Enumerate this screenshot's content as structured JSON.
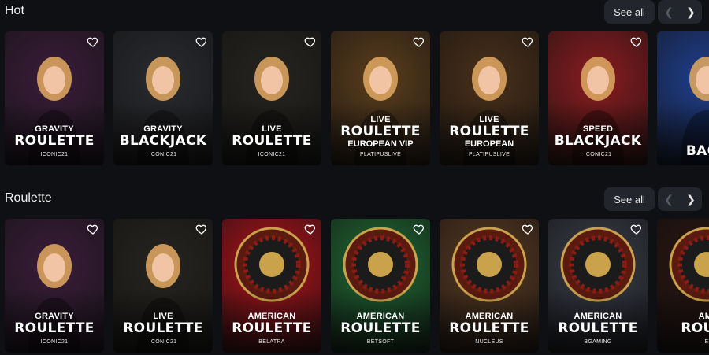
{
  "sections": {
    "hot": {
      "title": "Hot",
      "see_all": "See all",
      "cards": [
        {
          "line1": "GRAVITY",
          "line2": "ROULETTE",
          "line3": "",
          "provider": "ICONIC21",
          "color": "#3a1d3a"
        },
        {
          "line1": "GRAVITY",
          "line2": "BLACKJACK",
          "line3": "",
          "provider": "ICONIC21",
          "color": "#2a2b30"
        },
        {
          "line1": "LIVE",
          "line2": "ROULETTE",
          "line3": "",
          "provider": "ICONIC21",
          "color": "#26241f"
        },
        {
          "line1": "LIVE",
          "line2": "ROULETTE",
          "line3": "EUROPEAN VIP",
          "provider": "PLATIPUSLIVE",
          "color": "#5b3d1c"
        },
        {
          "line1": "LIVE",
          "line2": "ROULETTE",
          "line3": "EUROPEAN",
          "provider": "PLATIPUSLIVE",
          "color": "#4a3019"
        },
        {
          "line1": "SPEED",
          "line2": "BLACKJACK",
          "line3": "",
          "provider": "ICONIC21",
          "color": "#8b1c1f"
        },
        {
          "line1": "",
          "line2": "BACC",
          "line3": "",
          "provider": "",
          "color": "#1f3f8f"
        }
      ]
    },
    "roulette": {
      "title": "Roulette",
      "see_all": "See all",
      "cards": [
        {
          "line1": "GRAVITY",
          "line2": "ROULETTE",
          "line3": "",
          "provider": "ICONIC21",
          "color": "#3a1d3a"
        },
        {
          "line1": "LIVE",
          "line2": "ROULETTE",
          "line3": "",
          "provider": "ICONIC21",
          "color": "#26241f"
        },
        {
          "line1": "AMERICAN",
          "line2": "ROULETTE",
          "line3": "",
          "provider": "BELATRA",
          "color": "#b0121a"
        },
        {
          "line1": "AMERICAN",
          "line2": "ROULETTE",
          "line3": "",
          "provider": "BETSOFT",
          "color": "#1f6a34"
        },
        {
          "line1": "AMERICAN",
          "line2": "ROULETTE",
          "line3": "",
          "provider": "NUCLEUS",
          "color": "#5a3a22"
        },
        {
          "line1": "AMERICAN",
          "line2": "ROULETTE",
          "line3": "",
          "provider": "BGAMING",
          "color": "#3a3d4a"
        },
        {
          "line1": "AMI",
          "line2": "ROULE",
          "line3": "",
          "provider": "E",
          "color": "#2a1410"
        }
      ]
    }
  },
  "icons": {
    "heart": "heart-icon",
    "prev": "chevron-left-icon",
    "next": "chevron-right-icon"
  }
}
